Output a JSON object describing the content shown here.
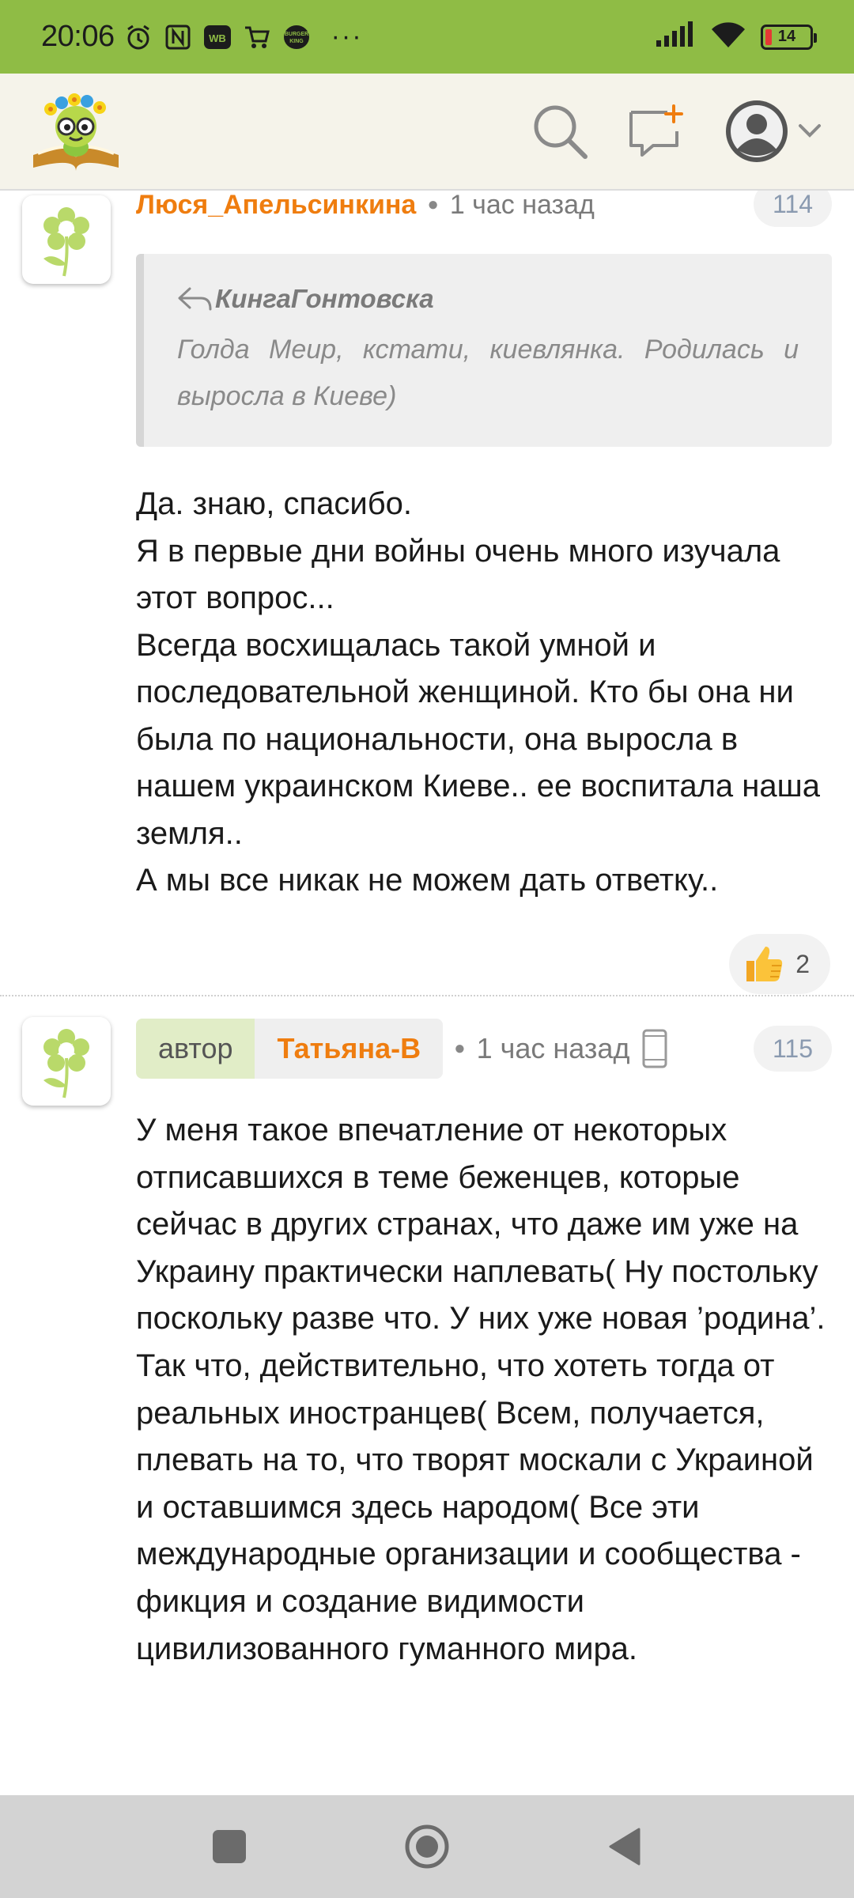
{
  "status_bar": {
    "time": "20:06",
    "battery": "14",
    "more": "···"
  },
  "header": {
    "logo_icon": "bookworm-logo-icon",
    "search_icon": "search-icon",
    "new_message_icon": "add-comment-icon",
    "profile_icon": "user-avatar-icon"
  },
  "comments": [
    {
      "author": "Люся_Апельсинкина",
      "time": "1 час назад",
      "number": "114",
      "quote": {
        "author": "КингаГонтовска",
        "text": "Голда Меир, кстати, киевлянка. Родилась и выросла в Киеве)"
      },
      "lines": [
        "Да. знаю, спасибо.",
        "Я в первые дни войны очень много изучала этот вопрос...",
        "Всегда восхищалась такой умной и последовательной женщиной. Кто бы она ни была по национальности, она выросла в нашем украинском Киеве.. ее воспитала наша земля..",
        "А мы все никак не можем дать ответку.."
      ],
      "likes": "2"
    },
    {
      "role": "автор",
      "author": "Татьяна-В",
      "time": "1 час назад",
      "number": "115",
      "text": "У меня такое впечатление от некоторых отписавшихся в теме беженцев, которые сейчас в других странах, что даже им уже на Украину практически наплевать( Ну постольку поскольку разве что. У них уже новая ’родина’. Так что, действительно, что хотеть тогда от реальных иностранцев( Всем, получается, плевать на то, что творят москали с Украиной и оставшимся здесь народом( Все эти международные организации и сообщества - фикция и создание видимости цивилизованного гуманного мира."
    }
  ],
  "colors": {
    "status_bar": "#8fbc45",
    "header_bg": "#f5f3ea",
    "author_accent": "#ef7d0f",
    "badge_role_bg": "#e1edc7"
  }
}
